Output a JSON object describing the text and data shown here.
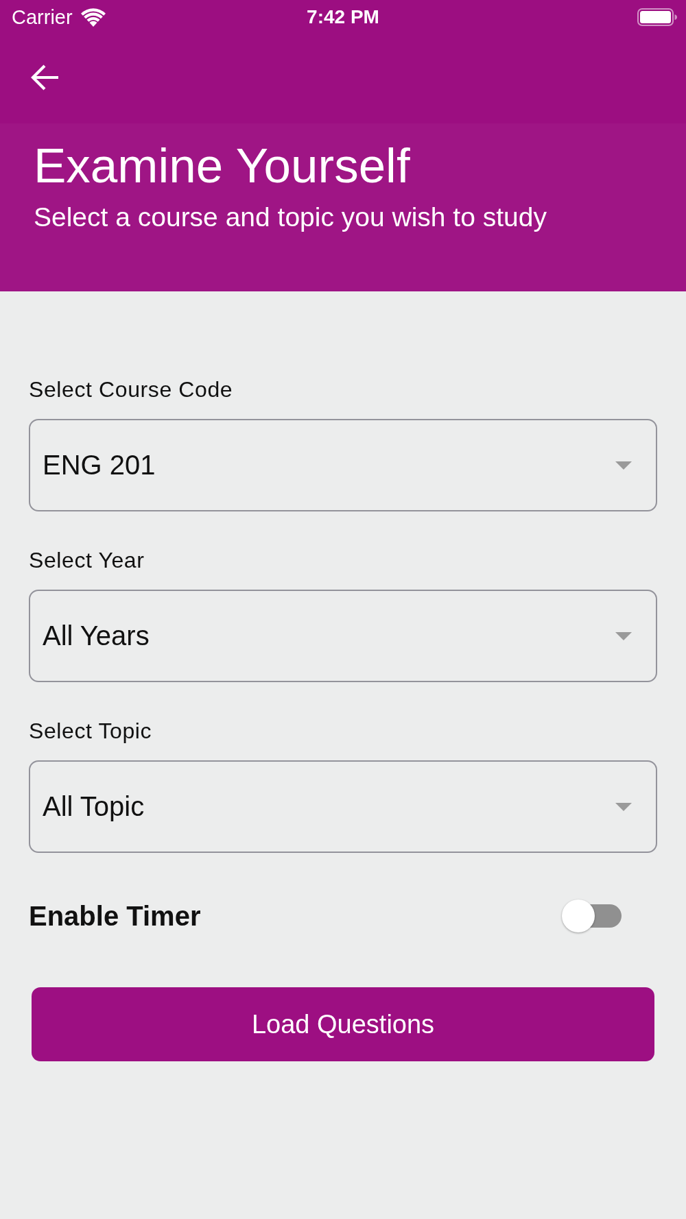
{
  "status_bar": {
    "carrier": "Carrier",
    "time": "7:42 PM"
  },
  "header": {
    "title": "Examine Yourself",
    "subtitle": "Select a course and topic you wish to study"
  },
  "fields": [
    {
      "label": "Select Course Code",
      "value": "ENG 201"
    },
    {
      "label": "Select Year",
      "value": "All Years"
    },
    {
      "label": "Select Topic",
      "value": "All Topic"
    }
  ],
  "timer": {
    "label": "Enable Timer",
    "on": false
  },
  "button": {
    "label": "Load Questions"
  }
}
